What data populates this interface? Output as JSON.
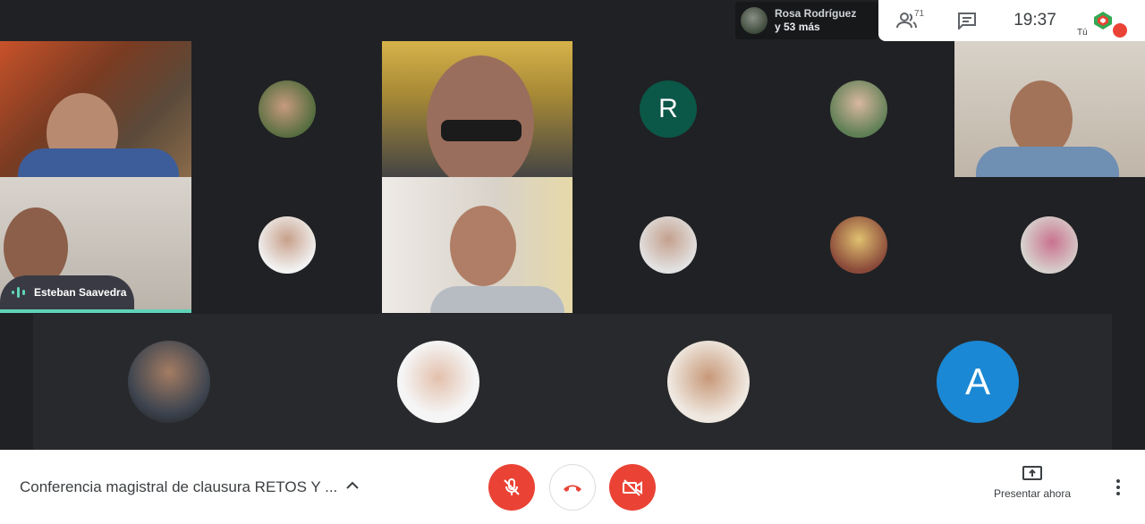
{
  "topbar": {
    "presenter_name": "Rosa Rodríguez",
    "presenter_more": "y 53 más",
    "participants_count": "71",
    "clock": "19:37",
    "self_label": "Tú"
  },
  "tiles": {
    "speaker_name": "Esteban Saavedra",
    "avatar_r_initial": "R",
    "avatar_a_initial": "A"
  },
  "bottombar": {
    "meeting_title": "Conferencia magistral de clausura RETOS Y ...",
    "present_label": "Presentar ahora"
  },
  "colors": {
    "end_call_red": "#ea4335",
    "avatar_r_bg": "#0b5748",
    "avatar_a_bg": "#1a88d4",
    "speaking_bar": "#5fd3b8"
  },
  "icons": [
    "people-icon",
    "chat-icon",
    "meet-logo-icon",
    "mic-off-icon",
    "hangup-icon",
    "camera-off-icon",
    "present-screen-icon",
    "more-vert-icon",
    "chevron-up-icon",
    "audio-wave-icon"
  ]
}
